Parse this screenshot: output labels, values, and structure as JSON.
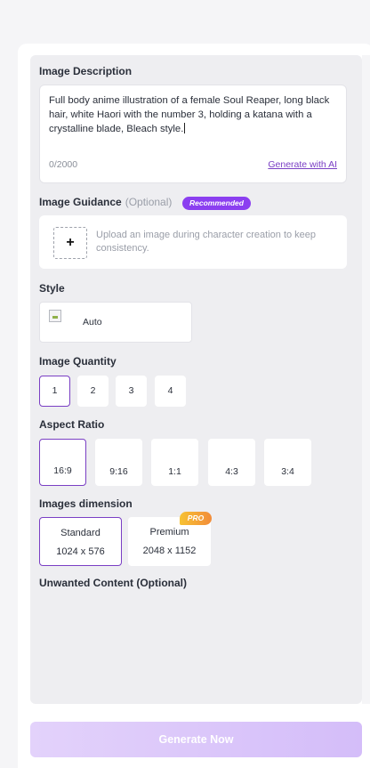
{
  "description": {
    "label": "Image Description",
    "value": "Full body anime illustration of a female Soul Reaper, long black hair, white Haori with the number 3, holding a katana with a crystalline blade, Bleach style.",
    "counter": "0/2000",
    "generate_ai": "Generate with AI"
  },
  "guidance": {
    "label": "Image Guidance",
    "optional": "(Optional)",
    "badge": "Recommended",
    "plus": "+",
    "hint": "Upload an image during character creation to keep consistency."
  },
  "style": {
    "label": "Style",
    "selected": "Auto"
  },
  "quantity": {
    "label": "Image Quantity",
    "options": [
      "1",
      "2",
      "3",
      "4"
    ],
    "selected": "1"
  },
  "aspect": {
    "label": "Aspect Ratio",
    "options": [
      "16:9",
      "9:16",
      "1:1",
      "4:3",
      "3:4"
    ],
    "selected": "16:9"
  },
  "dimension": {
    "label": "Images dimension",
    "options": [
      {
        "name": "Standard",
        "size": "1024 x 576"
      },
      {
        "name": "Premium",
        "size": "2048 x 1152"
      }
    ],
    "selected": "Standard",
    "pro_badge": "PRO"
  },
  "unwanted": {
    "label": "Unwanted Content (Optional)"
  },
  "generate_button": "Generate Now",
  "colors": {
    "accent": "#7a3fc4",
    "badge_purple": "#8b3ff0",
    "button_gradient_start": "#e3d2fb",
    "button_gradient_end": "#d4bdf9"
  }
}
